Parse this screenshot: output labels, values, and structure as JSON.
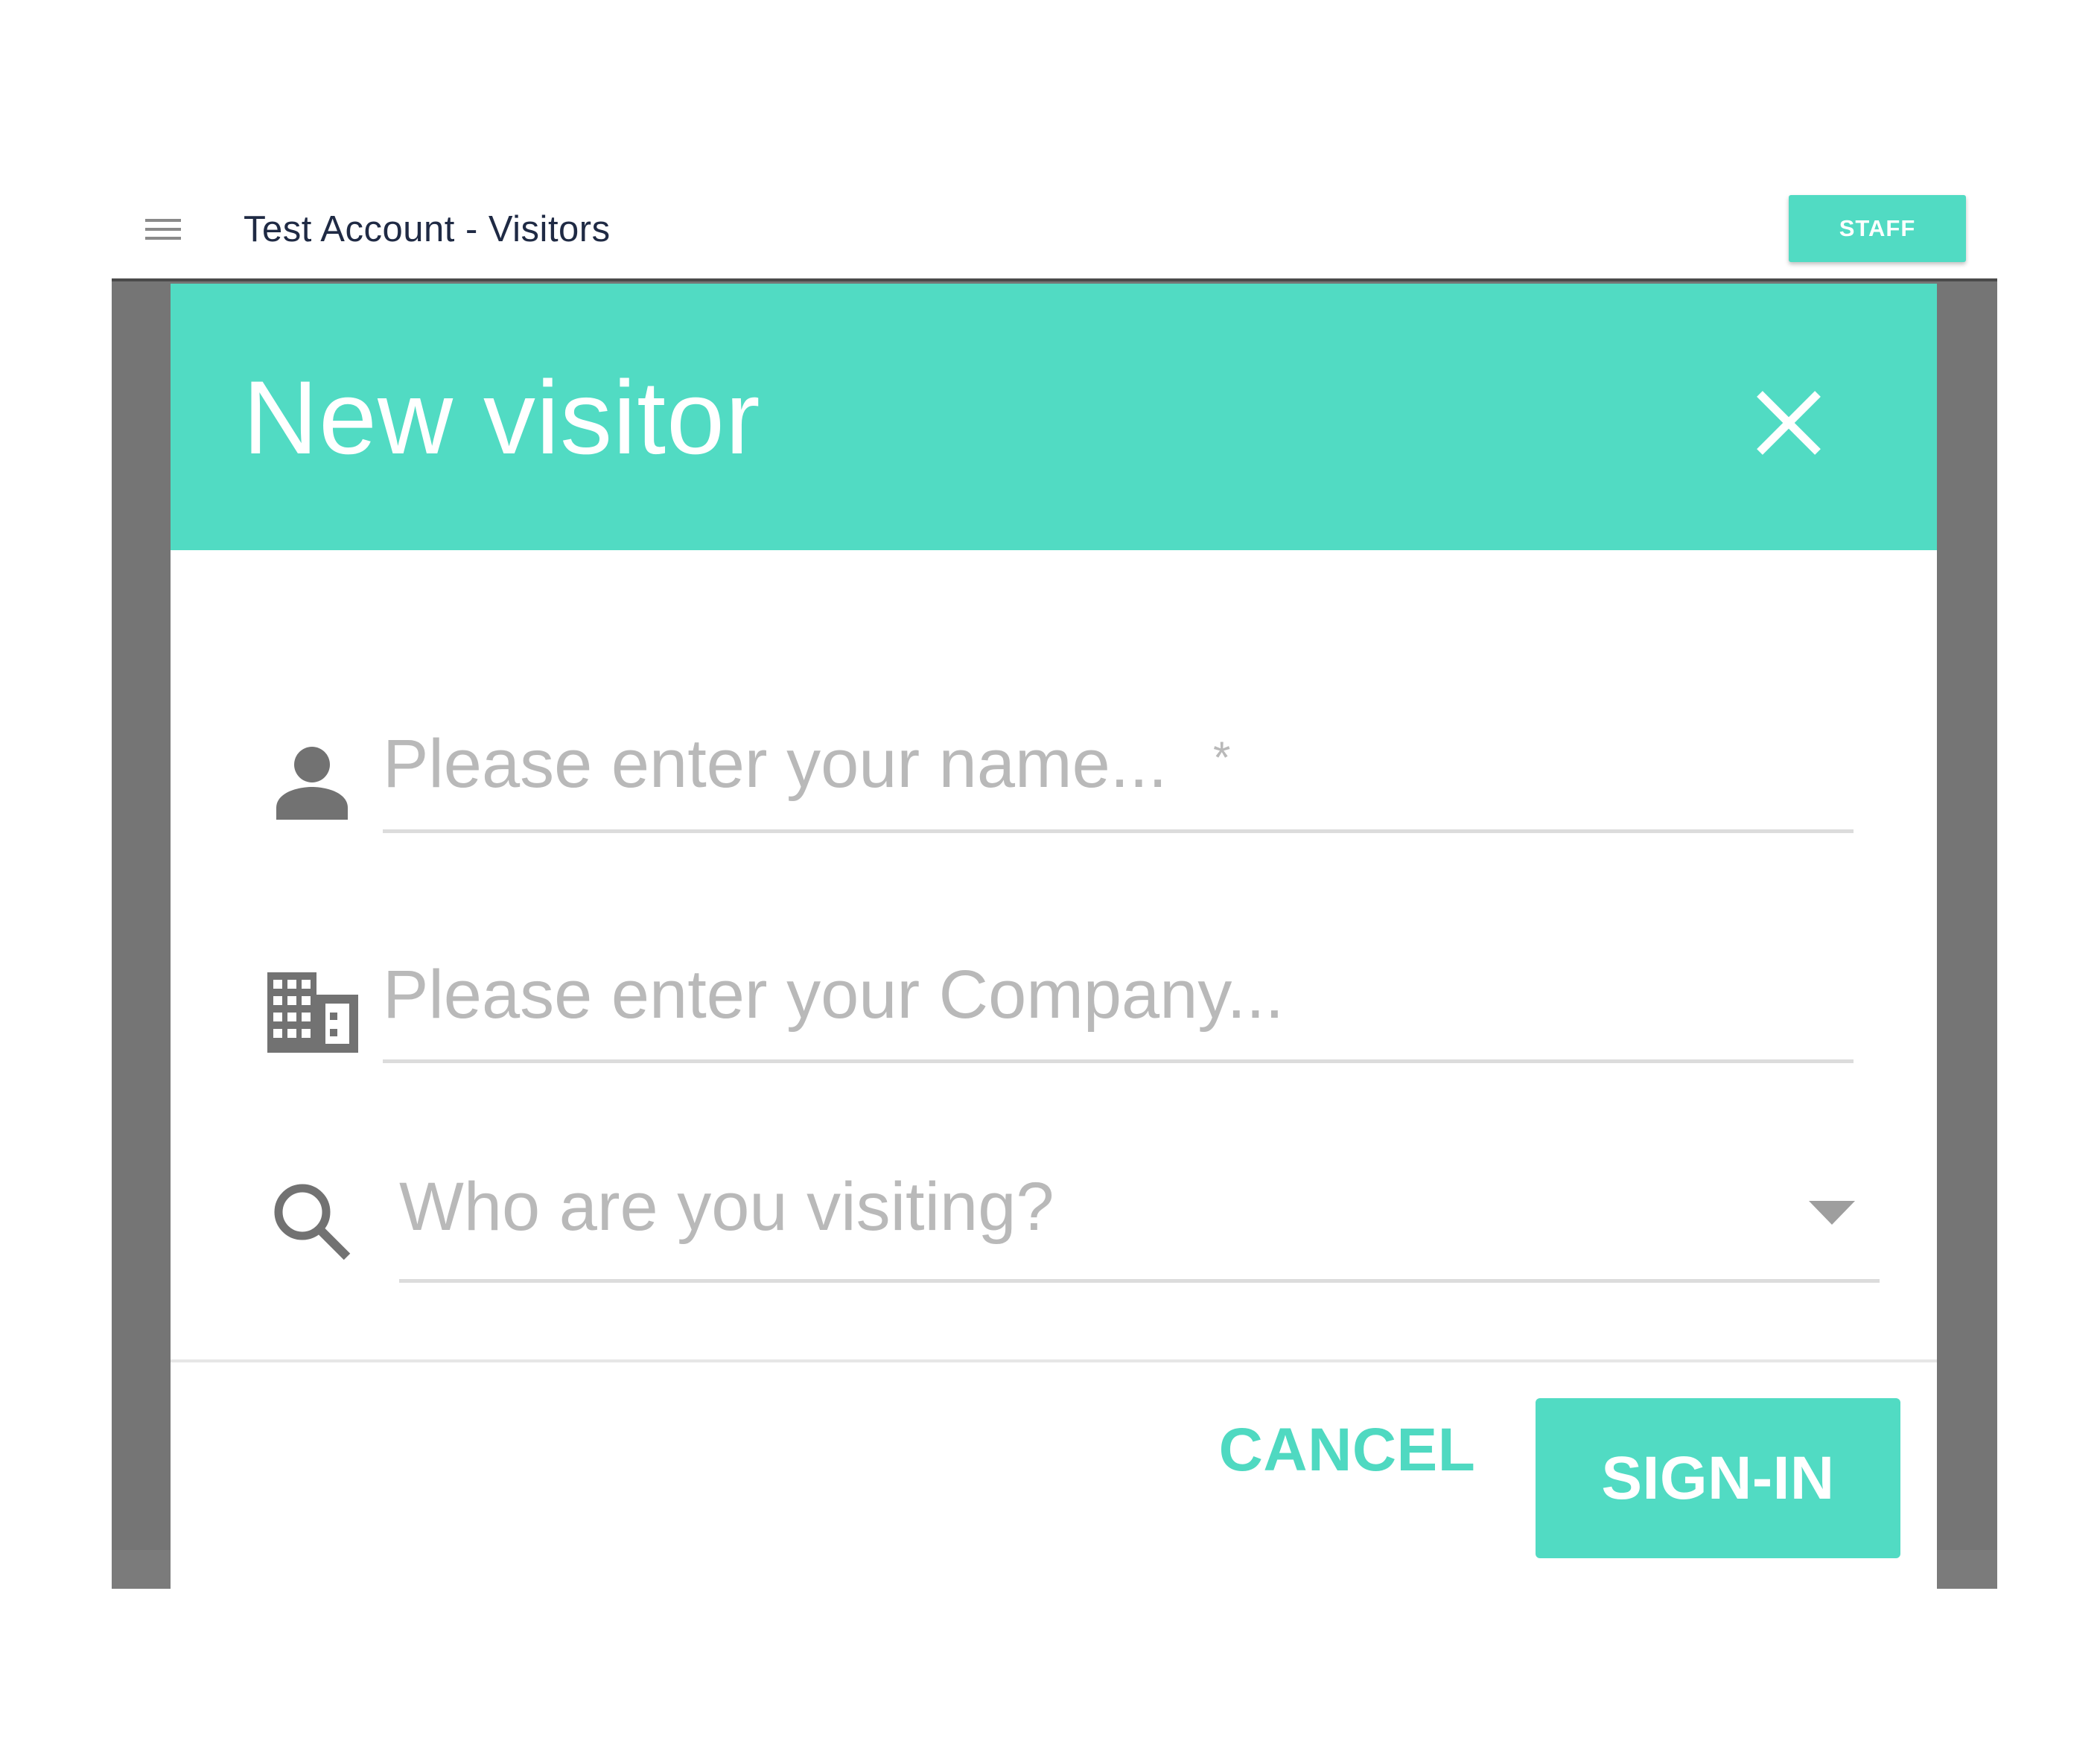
{
  "appbar": {
    "title": "Test Account - Visitors",
    "staff_label": "STAFF",
    "menu_icon": "hamburger-menu-icon"
  },
  "dialog": {
    "title": "New visitor",
    "close_icon": "close-icon",
    "fields": {
      "name": {
        "placeholder": "Please enter your name...",
        "required_mark": "*",
        "icon": "person-icon"
      },
      "company": {
        "placeholder": "Please enter your Company...",
        "icon": "building-icon"
      },
      "host": {
        "placeholder": "Who are you visiting?",
        "icon": "search-icon"
      }
    },
    "actions": {
      "cancel_label": "CANCEL",
      "signin_label": "SIGN-IN"
    }
  },
  "colors": {
    "accent": "#51dbc3",
    "overlay": "#757575",
    "placeholder": "#b9b9b9",
    "icon": "#727272"
  }
}
